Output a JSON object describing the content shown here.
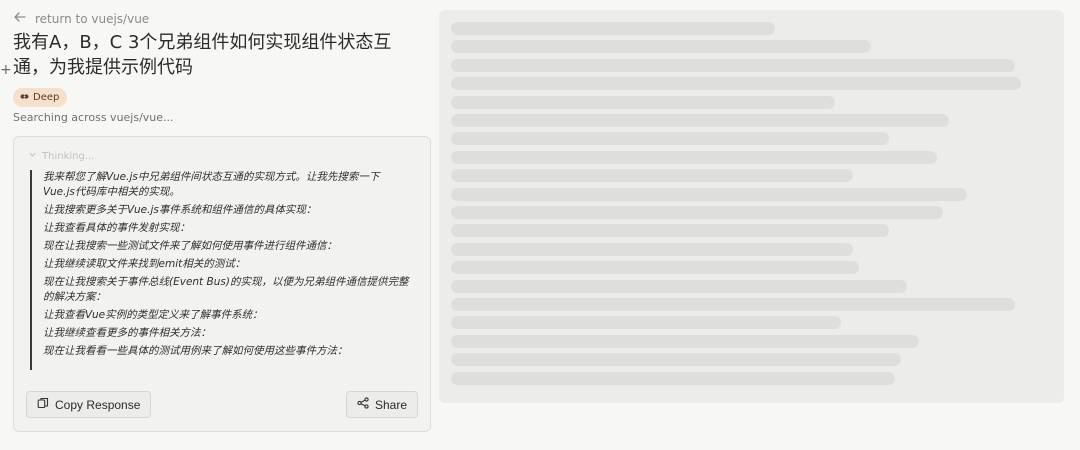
{
  "nav": {
    "back_label": "return to vuejs/vue"
  },
  "question": {
    "title": "我有A，B，C 3个兄弟组件如何实现组件状态互通，为我提供示例代码"
  },
  "mode_badge": {
    "label": "Deep",
    "icon": "sparkle-icon",
    "color": "#f6dfcc"
  },
  "status": {
    "text": "Searching across vuejs/vue..."
  },
  "thinking": {
    "label": "Thinking...",
    "steps": [
      "我来帮您了解Vue.js中兄弟组件间状态互通的实现方式。让我先搜索一下Vue.js代码库中相关的实现。",
      "让我搜索更多关于Vue.js事件系统和组件通信的具体实现：",
      "让我查看具体的事件发射实现：",
      "现在让我搜索一些测试文件来了解如何使用事件进行组件通信：",
      "让我继续读取文件来找到emit相关的测试：",
      "现在让我搜索关于事件总线(Event Bus)的实现，以便为兄弟组件通信提供完整的解决方案：",
      "让我查看Vue实例的类型定义来了解事件系统：",
      "让我继续查看更多的事件相关方法：",
      "现在让我看看一些具体的测试用例来了解如何使用这些事件方法："
    ]
  },
  "actions": {
    "copy_label": "Copy Response",
    "share_label": "Share"
  },
  "placeholder": {
    "line_count": 20
  }
}
